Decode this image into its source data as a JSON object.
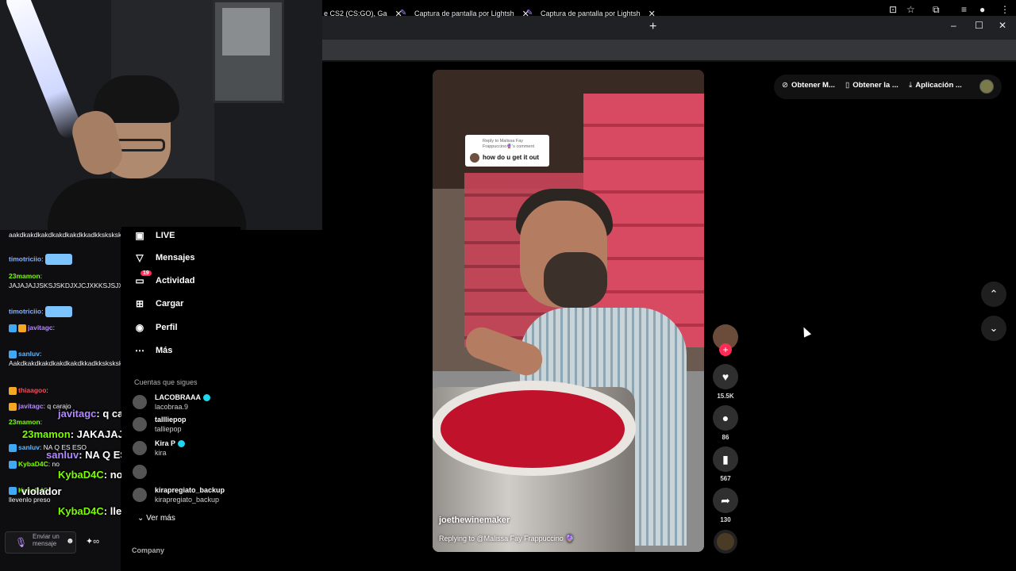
{
  "browser": {
    "tabs": [
      {
        "label": "e CS2 (CS:GO), Ga"
      },
      {
        "label": "Captura de pantalla por Lightsh"
      },
      {
        "label": "Captura de pantalla por Lightsh"
      }
    ],
    "new_tab": "+",
    "window_controls": {
      "minimize": "–",
      "maximize": "☐",
      "close": "✕"
    },
    "tab_close": "✕"
  },
  "chat": {
    "lines": [
      {
        "user": "",
        "text": "aakdkakdkakdkakdkakdkkadkksksksksksfkakfkakkdakdk",
        "color": "#efeff1"
      },
      {
        "user": "timotriciio",
        "text": ":",
        "color": "#8ab4ff",
        "emote": true
      },
      {
        "user": "23mamon",
        "text": ": JAJAJAJJSKSJSKDJXJCJXKKSJSJXJCV",
        "color": "#7cfc00"
      },
      {
        "user": "timotriciio",
        "text": ":",
        "color": "#8ab4ff",
        "emote": true
      },
      {
        "user": "javitagc",
        "text": ":",
        "color": "#b388ff"
      },
      {
        "user": "sanluv",
        "text": ": Aakdkakdkakdkakdkakdkkadkksksksksksfkakfkakkdakdk",
        "color": "#5fb8ff"
      },
      {
        "user": "thiaagoo",
        "text": ":",
        "color": "#ff4b5c"
      },
      {
        "user": "javitagc",
        "text": ": q carajo",
        "color": "#b388ff"
      },
      {
        "user": "23mamon",
        "text": ":",
        "color": "#7cfc00"
      },
      {
        "user": "sanluv",
        "text": ": NA Q ES ESO",
        "color": "#5fb8ff"
      },
      {
        "user": "KybaD4C",
        "text": ": no",
        "color": "#7cfc00"
      },
      {
        "user": "KybaD4C",
        "text": ":",
        "color": "#7cfc00"
      },
      {
        "user": "",
        "text": "llevenlo preso",
        "color": "#efeff1"
      }
    ],
    "input_placeholder": "Enviar un mensaje",
    "emoji_icon": "☻",
    "mic_icon": "🎙"
  },
  "overlay_chat": [
    {
      "user": "javitagc",
      "text": ": q carajo",
      "color": "purple"
    },
    {
      "user": "23mamon",
      "text": ": JAKAJAJAJAKSKJDJCJCJV",
      "color": "green"
    },
    {
      "user": "sanluv",
      "text": ": NA Q ES ESO",
      "color": "purple"
    },
    {
      "user": "KybaD4C",
      "text": ": no puede ser tan",
      "color": "green"
    },
    {
      "user": "",
      "text": "violador",
      "color": "white"
    },
    {
      "user": "KybaD4C",
      "text": ": llevenlo preso",
      "color": "green"
    }
  ],
  "sidebar": {
    "nav": [
      {
        "label": "LIVE",
        "icon": "live-icon"
      },
      {
        "label": "Mensajes",
        "icon": "messages-icon"
      },
      {
        "label": "Actividad",
        "icon": "activity-icon",
        "badge": "19"
      },
      {
        "label": "Cargar",
        "icon": "upload-icon"
      },
      {
        "label": "Perfil",
        "icon": "profile-icon"
      },
      {
        "label": "Más",
        "icon": "more-icon"
      }
    ],
    "following_heading": "Cuentas que sigues",
    "following": [
      {
        "name": "LACOBRAAA",
        "handle": "lacobraa.9",
        "verified": true
      },
      {
        "name": "tallliepop",
        "handle": "talliepop",
        "verified": false
      },
      {
        "name": "Kira P",
        "handle": "kira",
        "verified": true
      },
      {
        "name": "",
        "handle": "",
        "verified": false
      },
      {
        "name": "kirapregiato_backup",
        "handle": "kirapregiato_backup",
        "verified": false
      }
    ],
    "see_more": "Ver más",
    "company": "Company"
  },
  "top_buttons": {
    "coins": "Obtener M...",
    "app": "Obtener la ...",
    "download": "Aplicación ..."
  },
  "video": {
    "reply_header": "Reply to Malissa Fay Frappuccino🔮's comment",
    "reply_text": "how do u get it out",
    "author": "joethewinemaker",
    "caption": "Replying to @Malissa Fay Frappuccino 🔮"
  },
  "actions": {
    "likes": "15.5K",
    "comments": "86",
    "saves": "567",
    "shares": "130"
  },
  "colors": {
    "tiktok_red": "#fe2c55",
    "twitch_purple": "#b388ff",
    "browser_dark": "#202124"
  }
}
